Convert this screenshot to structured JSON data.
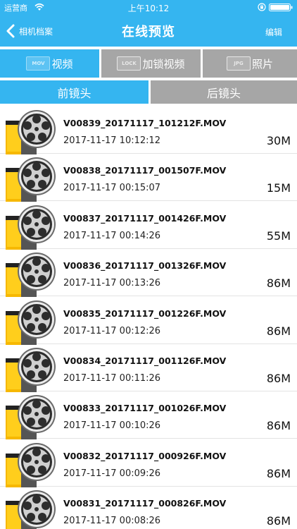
{
  "status_bar": {
    "carrier": "运营商",
    "time": "上午10:12"
  },
  "nav": {
    "back_label": "相机档案",
    "title": "在线预览",
    "edit_label": "编辑"
  },
  "categories": [
    {
      "label": "视频",
      "icon_text": "MOV",
      "active": true
    },
    {
      "label": "加锁视频",
      "icon_text": "LOCK",
      "active": false
    },
    {
      "label": "照片",
      "icon_text": "JPG",
      "active": false
    }
  ],
  "lens_tabs": [
    {
      "label": "前镜头",
      "active": true
    },
    {
      "label": "后镜头",
      "active": false
    }
  ],
  "files": [
    {
      "name": "V00839_20171117_101212F.MOV",
      "date": "2017-11-17 10:12:12",
      "size": "30M"
    },
    {
      "name": "V00838_20171117_001507F.MOV",
      "date": "2017-11-17 00:15:07",
      "size": "15M"
    },
    {
      "name": "V00837_20171117_001426F.MOV",
      "date": "2017-11-17 00:14:26",
      "size": "55M"
    },
    {
      "name": "V00836_20171117_001326F.MOV",
      "date": "2017-11-17 00:13:26",
      "size": "86M"
    },
    {
      "name": "V00835_20171117_001226F.MOV",
      "date": "2017-11-17 00:12:26",
      "size": "86M"
    },
    {
      "name": "V00834_20171117_001126F.MOV",
      "date": "2017-11-17 00:11:26",
      "size": "86M"
    },
    {
      "name": "V00833_20171117_001026F.MOV",
      "date": "2017-11-17 00:10:26",
      "size": "86M"
    },
    {
      "name": "V00832_20171117_000926F.MOV",
      "date": "2017-11-17 00:09:26",
      "size": "86M"
    },
    {
      "name": "V00831_20171117_000826F.MOV",
      "date": "2017-11-17 00:08:26",
      "size": "86M"
    }
  ],
  "colors": {
    "accent": "#35b5f0",
    "inactive_tab": "#a6a6a6"
  },
  "icons": {
    "back": "chevron-left-icon",
    "wifi": "wifi-icon",
    "lock": "orientation-lock-icon",
    "battery": "battery-icon",
    "thumb": "film-reel-icon"
  }
}
